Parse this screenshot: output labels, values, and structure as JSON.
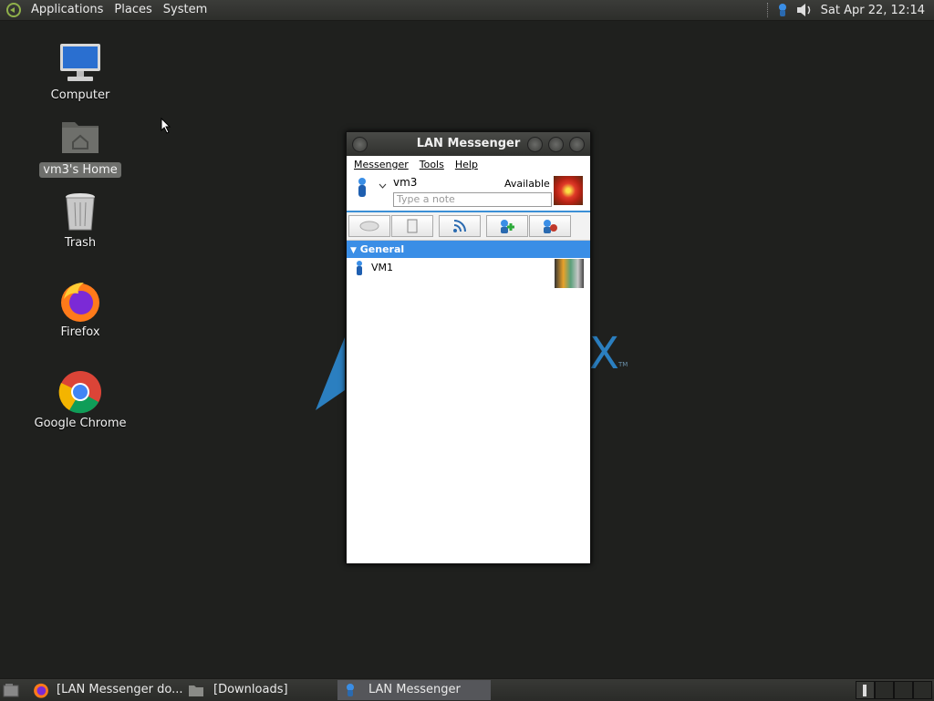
{
  "top_panel": {
    "menus": [
      "Applications",
      "Places",
      "System"
    ],
    "clock": "Sat Apr 22, 12:14"
  },
  "desktop": {
    "icons": [
      {
        "label": "Computer",
        "icon": "computer-icon"
      },
      {
        "label": "vm3's Home",
        "icon": "home-folder-icon"
      },
      {
        "label": "Trash",
        "icon": "trash-icon"
      },
      {
        "label": "Firefox",
        "icon": "firefox-icon"
      },
      {
        "label": "Google Chrome",
        "icon": "chrome-icon"
      }
    ],
    "background_letter": "X",
    "background_tm": "TM"
  },
  "window": {
    "title": "LAN Messenger",
    "menu": [
      "Messenger",
      "Tools",
      "Help"
    ],
    "user": {
      "name": "vm3",
      "status": "Available",
      "note_placeholder": "Type a note"
    },
    "toolbar": [
      "chat-icon",
      "file-icon",
      "broadcast-icon",
      "add-contact-icon",
      "settings-icon"
    ],
    "group": "General",
    "contacts": [
      {
        "name": "VM1"
      }
    ]
  },
  "bottom_panel": {
    "tasks": [
      {
        "label": "[LAN Messenger do...",
        "icon": "firefox-icon"
      },
      {
        "label": "[Downloads]",
        "icon": "folder-icon"
      },
      {
        "label": "LAN Messenger",
        "icon": "lan-messenger-icon",
        "active": true
      }
    ]
  },
  "colors": {
    "accent": "#3a8ee6",
    "desktop_bg": "#1f201e"
  }
}
